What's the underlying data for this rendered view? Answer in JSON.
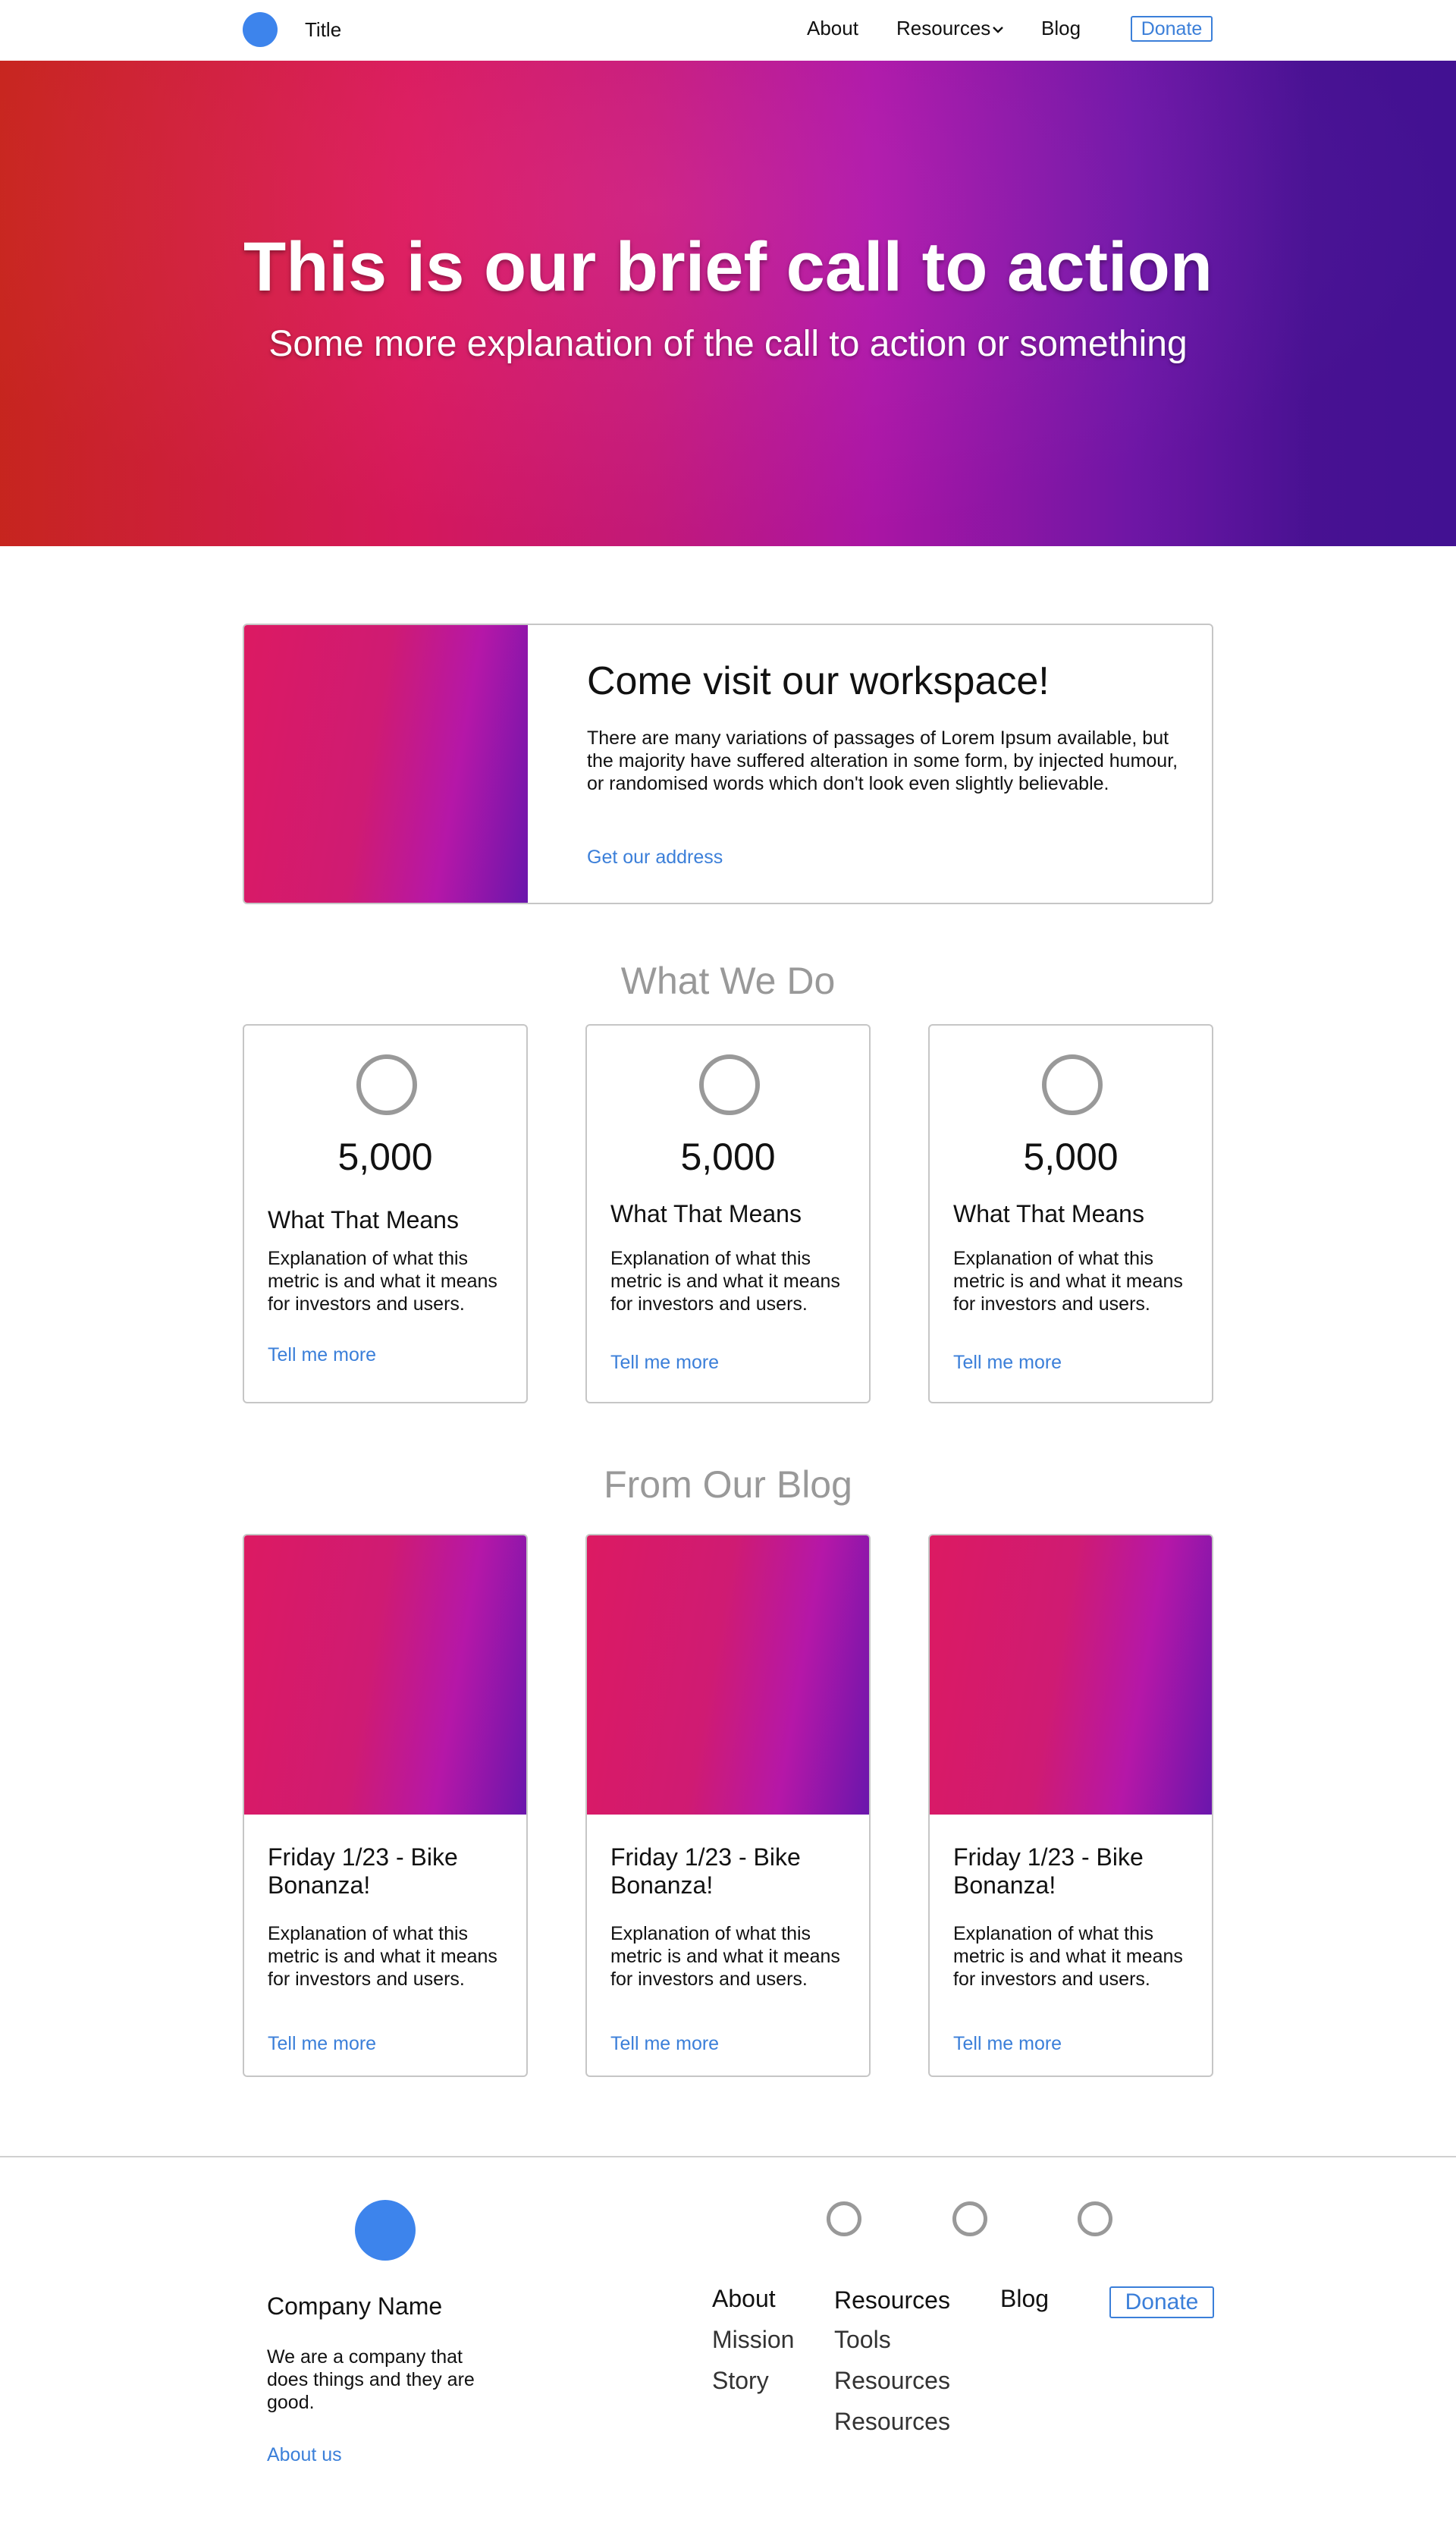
{
  "nav": {
    "title": "Title",
    "links": [
      "About",
      "Resources",
      "Blog"
    ],
    "donate": "Donate",
    "logo_color": "#3d84ec"
  },
  "hero": {
    "title": "This is our brief call to action",
    "subtitle": "Some more explanation of the call to action or something"
  },
  "feature": {
    "title": "Come visit our workspace!",
    "text": "There are many variations of passages of Lorem Ipsum available, but the majority have suffered alteration in some form, by injected humour, or randomised words which don't look even slightly believable.",
    "link": "Get our address"
  },
  "what_we_do": {
    "heading": "What We Do",
    "cards": [
      {
        "value": "5,000",
        "label": "What That Means",
        "text": "Explanation of what this metric is and what it means for investors and users.",
        "link": "Tell me more"
      },
      {
        "value": "5,000",
        "label": "What That Means",
        "text": "Explanation of what this metric is and what it means for investors and users.",
        "link": "Tell me more"
      },
      {
        "value": "5,000",
        "label": "What That Means",
        "text": "Explanation of what this metric is and what it means for investors and users.",
        "link": "Tell me more"
      }
    ]
  },
  "blog": {
    "heading": "From Our Blog",
    "posts": [
      {
        "title": "Friday 1/23 - Bike Bonanza!",
        "text": "Explanation of what this metric is and what it means for investors and users.",
        "link": "Tell me more"
      },
      {
        "title": "Friday 1/23 - Bike Bonanza!",
        "text": "Explanation of what this metric is and what it means for investors and users.",
        "link": "Tell me more"
      },
      {
        "title": "Friday 1/23 - Bike Bonanza!",
        "text": "Explanation of what this metric is and what it means for investors and users.",
        "link": "Tell me more"
      }
    ]
  },
  "footer": {
    "company_name": "Company Name",
    "about_text": "We are a company that does things and they are good.",
    "about_link": "About us",
    "columns": [
      {
        "heading": "About",
        "items": [
          "Mission",
          "Story"
        ]
      },
      {
        "heading": "Resources",
        "items": [
          "Tools",
          "Resources",
          "Resources"
        ]
      },
      {
        "heading": "Blog",
        "items": []
      }
    ],
    "donate": "Donate"
  },
  "colors": {
    "accent": "#3b7fd9",
    "muted": "#999999",
    "border": "#c6c6c6"
  }
}
